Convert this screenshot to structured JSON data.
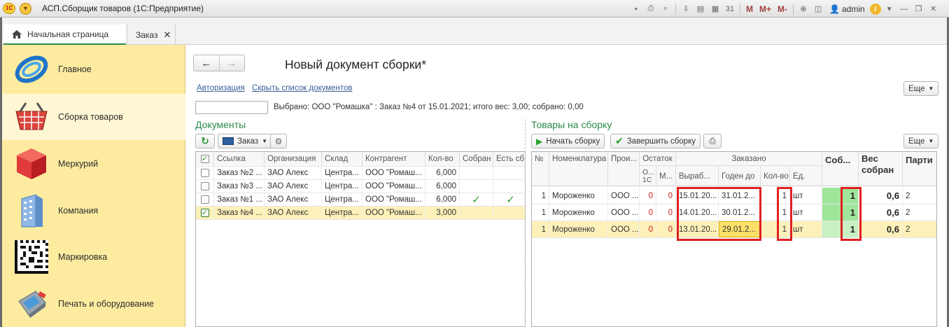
{
  "window": {
    "title": "АСП.Сборщик товаров  (1С:Предприятие)",
    "logo_text": "1С",
    "user": "admin",
    "toolbar_m": [
      "M",
      "M+",
      "M-"
    ]
  },
  "tabs": [
    {
      "label": "Начальная страница"
    },
    {
      "label": "Заказ"
    }
  ],
  "sidebar": {
    "items": [
      {
        "label": "Главное"
      },
      {
        "label": "Сборка товаров"
      },
      {
        "label": "Меркурий"
      },
      {
        "label": "Компания"
      },
      {
        "label": "Маркировка"
      },
      {
        "label": "Печать и оборудование"
      }
    ]
  },
  "main": {
    "title": "Новый документ сборки*",
    "links": [
      "Авторизация",
      "Скрыть список документов"
    ],
    "more_label": "Еще",
    "selected_info": "Выбрано: ООО \"Ромашка\" : Заказ №4 от 15.01.2021; итого вес: 3,00; собрано: 0,00",
    "search_value": ""
  },
  "documents": {
    "title": "Документы",
    "order_button": "Заказ",
    "columns": [
      "Ссылка",
      "Организация",
      "Склад",
      "Контрагент",
      "Кол-во",
      "Собран",
      "Есть сб"
    ],
    "rows": [
      {
        "ref": "Заказ №2 ...",
        "org": "ЗАО Алекс",
        "stock": "Центра...",
        "partner": "ООО \"Ромаш...",
        "qty": "6,000",
        "collected": false,
        "has": false,
        "checked": false
      },
      {
        "ref": "Заказ №3 ...",
        "org": "ЗАО Алекс",
        "stock": "Центра...",
        "partner": "ООО \"Ромаш...",
        "qty": "6,000",
        "collected": false,
        "has": false,
        "checked": false
      },
      {
        "ref": "Заказ №1 ...",
        "org": "ЗАО Алекс",
        "stock": "Центра...",
        "partner": "ООО \"Ромаш...",
        "qty": "6,000",
        "collected": true,
        "has": true,
        "checked": false
      },
      {
        "ref": "Заказ №4 ...",
        "org": "ЗАО Алекс",
        "stock": "Центра...",
        "partner": "ООО \"Ромаш...",
        "qty": "3,000",
        "collected": false,
        "has": false,
        "checked": true
      }
    ]
  },
  "goods": {
    "title": "Товары на сборку",
    "start_button": "Начать сборку",
    "finish_button": "Завершить сборку",
    "more_label": "Еще",
    "headers": {
      "num": "№",
      "nomenclature": "Номенклатура",
      "producer": "Прои...",
      "remainder": "Остаток",
      "rem_1c": "О... 1С",
      "rem_m": "М...",
      "ordered": "Заказано",
      "produced": "Выраб...",
      "valid_till": "Годен до",
      "qty": "Кол-во",
      "unit": "Ед.",
      "collected": "Соб...",
      "weight": "Вес собран",
      "party": "Парти"
    },
    "rows": [
      {
        "n": "1",
        "name": "Мороженко",
        "prod": "ООО ...",
        "r1c": "0",
        "rm": "0",
        "produced": "15.01.20...",
        "valid": "31.01.2...",
        "qty": "1",
        "unit": "шт",
        "collected": "1",
        "weight": "0,6",
        "party": "2"
      },
      {
        "n": "1",
        "name": "Мороженко",
        "prod": "ООО ...",
        "r1c": "0",
        "rm": "0",
        "produced": "14.01.20...",
        "valid": "30.01.2...",
        "qty": "1",
        "unit": "шт",
        "collected": "1",
        "weight": "0,6",
        "party": "2"
      },
      {
        "n": "1",
        "name": "Мороженко",
        "prod": "ООО ...",
        "r1c": "0",
        "rm": "0",
        "produced": "13.01.20...",
        "valid": "29.01.2...",
        "qty": "1",
        "unit": "шт",
        "collected": "1",
        "weight": "0,6",
        "party": "2"
      }
    ]
  },
  "colors": {
    "accent_green": "#2a8a4a",
    "sidebar_bg": "#fdeca0",
    "highlight_red": "#e02020",
    "selected_row": "#fdf1b9"
  }
}
